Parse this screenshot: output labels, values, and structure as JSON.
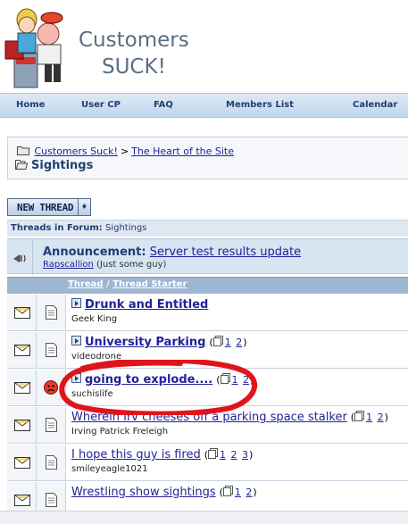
{
  "site": {
    "logo_line1": "Customers",
    "logo_line2": "SUCK!"
  },
  "navbar": {
    "items": [
      "Home",
      "User CP",
      "FAQ",
      "Members List",
      "Calendar"
    ]
  },
  "breadcrumb": {
    "link1": "Customers Suck!",
    "separator": ">",
    "link2": "The Heart of the Site",
    "current": "Sightings"
  },
  "new_thread_button": {
    "label": "NEW THREAD",
    "dropdown_glyph": "♦"
  },
  "forum_bar": {
    "prefix": "Threads in Forum",
    "colon": ":",
    "forum_name": "Sightings"
  },
  "announcement": {
    "label": "Announcement:",
    "title": "Server test results update",
    "author": "Rapscallion",
    "author_note": "(Just some guy)"
  },
  "column_header": {
    "thread": "Thread",
    "slash": "/",
    "starter": "Thread Starter"
  },
  "threads": [
    {
      "title": "Drunk and Entitled",
      "starter": "Geek King",
      "bold": true,
      "has_arrow": true,
      "pages": [],
      "rating_icon": "note-icon"
    },
    {
      "title": "University Parking",
      "starter": "videodrone",
      "bold": true,
      "has_arrow": true,
      "pages": [
        "1",
        "2"
      ],
      "rating_icon": "note-icon"
    },
    {
      "title": "going to explode....",
      "starter": "suchislife",
      "bold": true,
      "has_arrow": true,
      "pages": [
        "1",
        "2"
      ],
      "rating_icon": "angry-face-icon"
    },
    {
      "title": "Wherein Irv cheeses off a parking space stalker",
      "starter": "Irving Patrick Freleigh",
      "bold": false,
      "has_arrow": false,
      "pages": [
        "1",
        "2"
      ],
      "rating_icon": "note-icon"
    },
    {
      "title": "I hope this guy is fired",
      "starter": "smileyeagle1021",
      "bold": false,
      "has_arrow": false,
      "pages": [
        "1",
        "2",
        "3"
      ],
      "rating_icon": "note-icon"
    },
    {
      "title": "Wrestling show sightings",
      "starter": "",
      "bold": false,
      "has_arrow": false,
      "pages": [
        "1",
        "2"
      ],
      "rating_icon": "note-icon"
    }
  ],
  "colors": {
    "link": "#22229c",
    "annotation_circle": "#e0141b",
    "nav_gradient_top": "#dde9f5",
    "header_column": "#9db6d2"
  }
}
